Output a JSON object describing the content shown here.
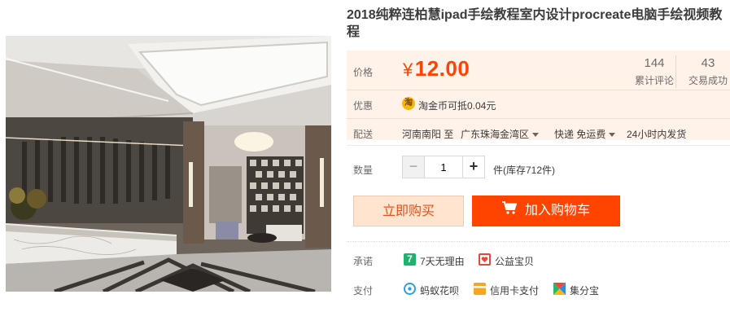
{
  "product": {
    "title": "2018纯粹连柏慧ipad手绘教程室内设计procreate电脑手绘视频教程"
  },
  "price": {
    "label": "价格",
    "currency": "¥",
    "amount": "12.00"
  },
  "stats": {
    "reviews_count": "144",
    "reviews_label": "累计评论",
    "sales_count": "43",
    "sales_label": "交易成功"
  },
  "promo": {
    "label": "优惠",
    "coin_icon_text": "淘",
    "text": "淘金币可抵0.04元"
  },
  "shipping": {
    "label": "配送",
    "from": "河南南阳 至",
    "to": "广东珠海金湾区",
    "method": "快递 免运费",
    "dispatch": "24小时内发货"
  },
  "quantity": {
    "label": "数量",
    "minus": "−",
    "value": "1",
    "plus": "+",
    "stock": "件(库存712件)"
  },
  "actions": {
    "buy_now": "立即购买",
    "add_to_cart": "加入购物车"
  },
  "guarantee": {
    "label": "承诺",
    "items": [
      {
        "icon": "seven-day-icon",
        "icon_text": "7",
        "text": "7天无理由"
      },
      {
        "icon": "charity-icon",
        "icon_text": "",
        "text": "公益宝贝"
      }
    ]
  },
  "payment": {
    "label": "支付",
    "items": [
      {
        "icon": "huabei-icon",
        "text": "蚂蚁花呗"
      },
      {
        "icon": "credit-card-icon",
        "text": "信用卡支付"
      },
      {
        "icon": "jifenbao-icon",
        "text": "集分宝"
      }
    ]
  },
  "colors": {
    "accent": "#ff4400",
    "price_bg": "#fff2e8",
    "buy_bg": "#ffe4d0"
  }
}
